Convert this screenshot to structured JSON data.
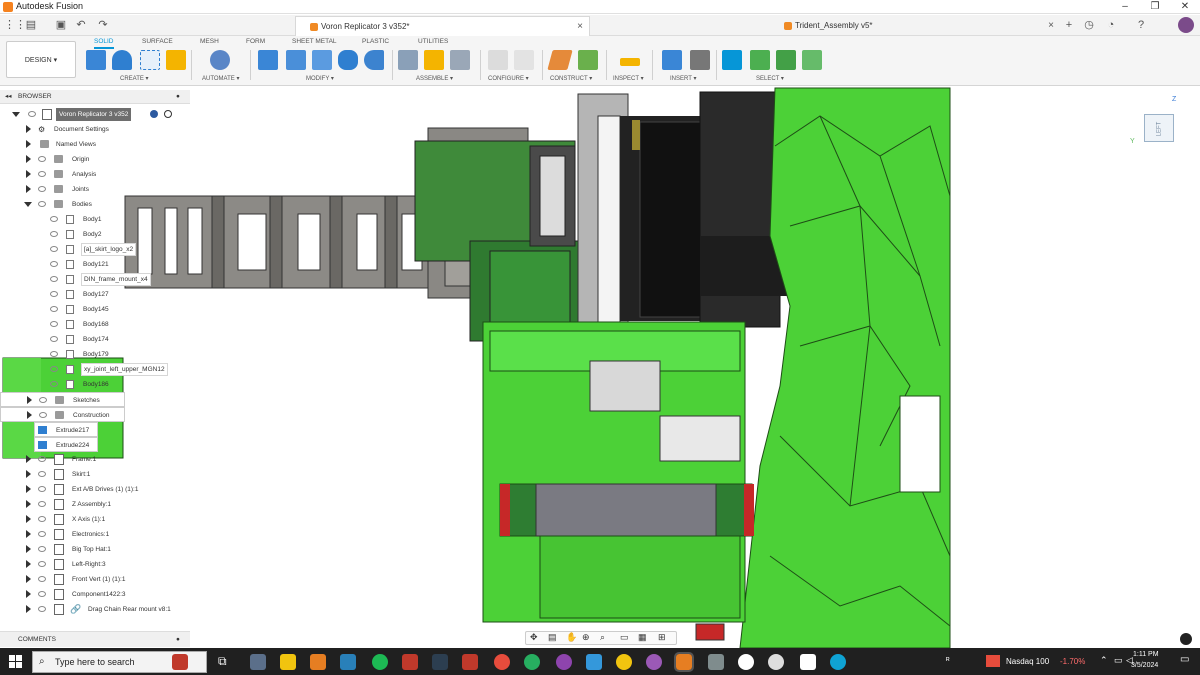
{
  "window": {
    "title": "Autodesk Fusion",
    "minimize": "–",
    "maximize": "❐",
    "close": "✕"
  },
  "tabs": [
    {
      "label": "Voron Replicator 3 v352*",
      "close": "×"
    },
    {
      "label": "Trident_Assembly v5*",
      "close": "×"
    }
  ],
  "tabstrip_icons": {
    "add": "+",
    "count1": "1",
    "count2": "1"
  },
  "ribbon": {
    "design": "DESIGN ▾",
    "tabs": [
      "SOLID",
      "SURFACE",
      "MESH",
      "FORM",
      "SHEET METAL",
      "PLASTIC",
      "UTILITIES"
    ],
    "groups": [
      "CREATE ▾",
      "AUTOMATE ▾",
      "MODIFY ▾",
      "ASSEMBLE ▾",
      "CONFIGURE ▾",
      "CONSTRUCT ▾",
      "INSPECT ▾",
      "INSERT ▾",
      "SELECT ▾"
    ]
  },
  "browser": {
    "title": "BROWSER",
    "root": "Voron Replicator 3 v352",
    "items": [
      "Document Settings",
      "Named Views",
      "Origin",
      "Analysis",
      "Joints",
      "Bodies",
      "Body1",
      "Body2",
      "[a]_skirt_logo_x2",
      "Body121",
      "DIN_frame_mount_x4",
      "Body127",
      "Body145",
      "Body168",
      "Body174",
      "Body179",
      "xy_joint_left_upper_MGN12",
      "Body186",
      "Sketches",
      "Construction",
      "Extrude217",
      "Extrude224",
      "Frame:1",
      "Skirt:1",
      "Ext A/B Drives (1) (1):1",
      "Z Assembly:1",
      "X Axis (1):1",
      "Electronics:1",
      "Big Top Hat:1",
      "Left-Right:3",
      "Front Vert (1) (1):1",
      "Component1422:3",
      "Drag Chain Rear mount v8:1"
    ]
  },
  "comments": {
    "label": "COMMENTS"
  },
  "viewcube": {
    "face": "LEFT",
    "z": "Z",
    "y": "Y"
  },
  "taskbar": {
    "search_placeholder": "Type here to search",
    "ticker_label": "Nasdaq 100",
    "ticker_value": "-1.70%",
    "time": "1:11 PM",
    "date": "3/5/2024"
  },
  "colors": {
    "model_green": "#4cd137",
    "accent": "#0696d7",
    "taskbar": "#202020"
  }
}
